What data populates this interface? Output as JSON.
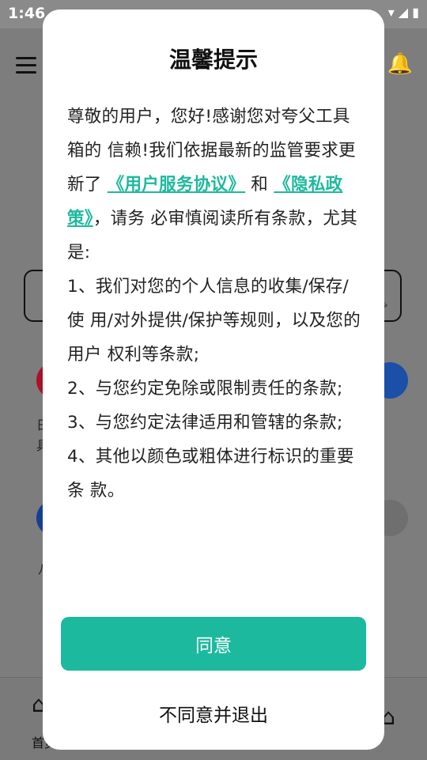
{
  "status_bar": {
    "time": "1:46",
    "icons": "▾ ◢ ▮"
  },
  "background": {
    "labels": [
      "日",
      "具",
      "八"
    ],
    "bottom_nav": {
      "home_label": "首页"
    }
  },
  "dialog": {
    "title": "温馨提示",
    "intro_before_link1": "尊敬的用户，您好!感谢您对夸父工具箱的 信赖!我们依据最新的监管要求更新了 ",
    "link_user_agreement": "《用户服务协议》",
    "and": " 和 ",
    "link_privacy": "《隐私政策》",
    "intro_after_links": "，请务 必审慎阅读所有条款，尤其是:",
    "clauses": [
      " 1、我们对您的个人信息的收集/保存/使 用/对外提供/保护等规则，以及您的用户 权利等条款;",
      " 2、与您约定免除或限制责任的条款;",
      " 3、与您约定法律适用和管辖的条款;",
      " 4、其他以颜色或粗体进行标识的重要条 款。"
    ],
    "agree_label": "同意",
    "disagree_label": "不同意并退出"
  },
  "colors": {
    "accent": "#1db99e",
    "overlay": "#7d7d7d"
  }
}
